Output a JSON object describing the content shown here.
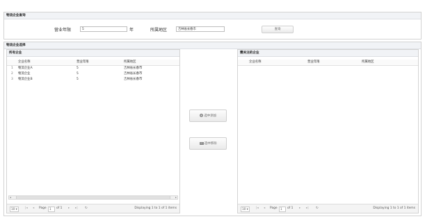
{
  "query_section": {
    "title": "物流企业查询",
    "years_label": "营业年限",
    "years_value": "5",
    "years_unit": "年",
    "region_label": "所属地区",
    "region_value": "吉林省长春市",
    "query_button": "查询"
  },
  "select_section": {
    "title": "物流企业选择"
  },
  "all_companies": {
    "title": "所有企业",
    "columns": [
      "企业名称",
      "营业年限",
      "所属地区"
    ],
    "rows": [
      {
        "index": "1",
        "name": "物流企业A",
        "years": "5",
        "region": "吉林省长春市"
      },
      {
        "index": "2",
        "name": "物流企业",
        "years": "5",
        "region": "吉林省长春市"
      },
      {
        "index": "3",
        "name": "物流企业B",
        "years": "5",
        "region": "吉林省长春市"
      }
    ],
    "pager": {
      "page_size": "10",
      "page_label": "Page",
      "page_value": "1",
      "of_label": "of 1",
      "display_text": "Displaying 1 to 1 of 1 items"
    }
  },
  "actions": {
    "add_button": "选中添加",
    "remove_button": "选中移除"
  },
  "followed_companies": {
    "title": "需关注的企业",
    "columns": [
      "企业名称",
      "营业年限",
      "所属地区"
    ],
    "pager": {
      "page_size": "10",
      "page_label": "Page",
      "page_value": "1",
      "of_label": "of 1",
      "display_text": "Displaying 1 to 1 of 1 items"
    }
  },
  "icons": {
    "add": "plus-circle-icon",
    "remove": "minus-rectangle-icon",
    "first": "first-page-icon",
    "prev": "prev-page-icon",
    "next": "next-page-icon",
    "last": "last-page-icon",
    "refresh": "refresh-icon"
  }
}
